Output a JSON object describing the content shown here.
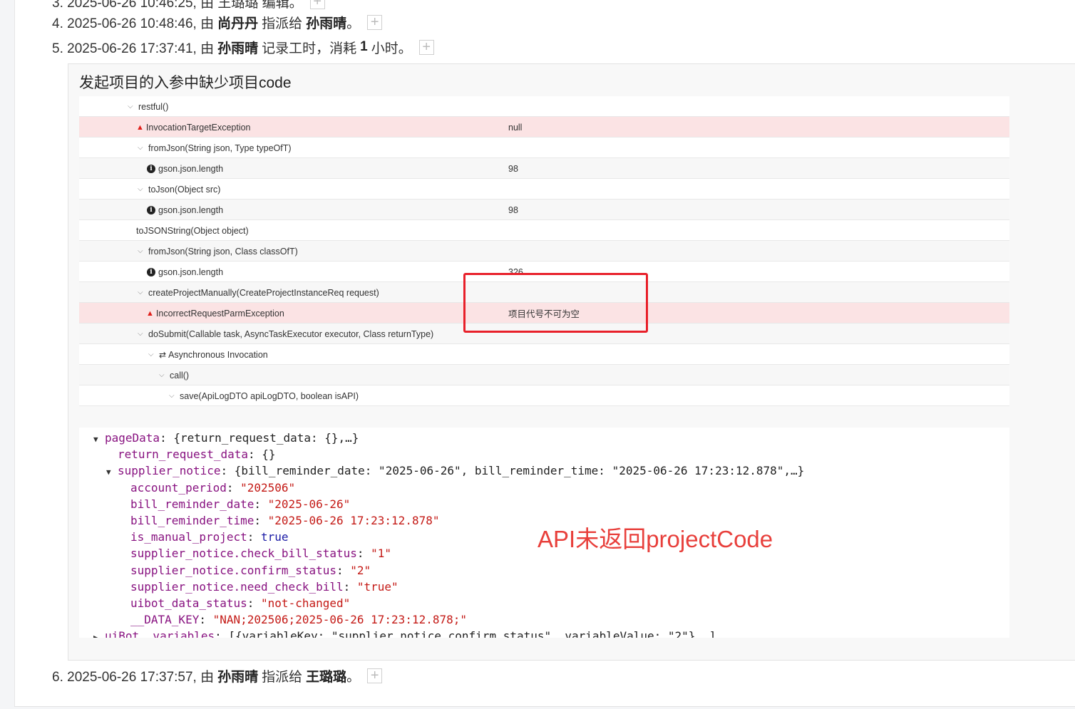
{
  "history": {
    "line3_partial": "3. 2025-06-26 10:46:25, 由 王璐璐 编辑。",
    "line4": {
      "prefix": "4. 2025-06-26 10:48:46, 由",
      "actor": "尚丹丹",
      "action": "指派给",
      "target": "孙雨晴",
      "suffix": "。"
    },
    "line5": {
      "prefix": "5. 2025-06-26 17:37:41, 由",
      "actor": "孙雨晴",
      "action": "记录工时，消耗",
      "count": "1",
      "suffix": "小时。"
    },
    "line6": {
      "prefix": "6. 2025-06-26 17:37:57, 由",
      "actor": "孙雨晴",
      "action": "指派给",
      "target": "王璐璐",
      "suffix": "。"
    },
    "plus_label": "+"
  },
  "comment": {
    "title": "发起项目的入参中缺少项目code",
    "trace_rows": [
      {
        "label": "restful()",
        "value": "",
        "kind": "node",
        "indent": 68,
        "chevron": "⌵"
      },
      {
        "label": "InvocationTargetException",
        "value": "null",
        "kind": "error",
        "indent": 80
      },
      {
        "label": "fromJson(String json, Type typeOfT)",
        "value": "",
        "kind": "node",
        "indent": 82,
        "chevron": "⌵"
      },
      {
        "label": "gson.json.length",
        "value": "98",
        "kind": "info",
        "indent": 95
      },
      {
        "label": "toJson(Object src)",
        "value": "",
        "kind": "node",
        "indent": 82,
        "chevron": "⌵"
      },
      {
        "label": "gson.json.length",
        "value": "98",
        "kind": "info",
        "indent": 95
      },
      {
        "label": "toJSONString(Object object)",
        "value": "",
        "kind": "node",
        "indent": 80
      },
      {
        "label": "fromJson(String json, Class classOfT)",
        "value": "",
        "kind": "node",
        "indent": 82,
        "chevron": "⌵"
      },
      {
        "label": "gson.json.length",
        "value": "326",
        "kind": "info",
        "indent": 95
      },
      {
        "label": "createProjectManually(CreateProjectInstanceReq request)",
        "value": "",
        "kind": "node",
        "indent": 82,
        "chevron": "⌵"
      },
      {
        "label": "IncorrectRequestParmException",
        "value": "项目代号不可为空",
        "kind": "error",
        "indent": 94
      },
      {
        "label": "doSubmit(Callable task, AsyncTaskExecutor executor, Class returnType)",
        "value": "",
        "kind": "node",
        "indent": 82,
        "chevron": "⌵"
      },
      {
        "label": "Asynchronous Invocation",
        "value": "",
        "kind": "async",
        "indent": 97,
        "chevron": "⌵"
      },
      {
        "label": "call()",
        "value": "",
        "kind": "node",
        "indent": 112,
        "chevron": "⌵"
      },
      {
        "label": "save(ApiLogDTO apiLogDTO, boolean isAPI)",
        "value": "",
        "kind": "node",
        "indent": 126,
        "chevron": "⌵"
      }
    ],
    "json_lines": [
      {
        "indent": 20,
        "tri": "▼",
        "parts": [
          [
            "k",
            "pageData"
          ],
          [
            "p",
            ": {return_request_data: {},…}"
          ]
        ]
      },
      {
        "indent": 54,
        "tri": "",
        "parts": [
          [
            "k",
            "return_request_data"
          ],
          [
            "p",
            ": {}"
          ]
        ]
      },
      {
        "indent": 38,
        "tri": "▼",
        "parts": [
          [
            "k",
            "supplier_notice"
          ],
          [
            "p",
            ": {bill_reminder_date: \"2025-06-26\", bill_reminder_time: \"2025-06-26 17:23:12.878\",…}"
          ]
        ]
      },
      {
        "indent": 72,
        "tri": "",
        "parts": [
          [
            "k",
            "account_period"
          ],
          [
            "p",
            ": "
          ],
          [
            "s",
            "\"202506\""
          ]
        ]
      },
      {
        "indent": 72,
        "tri": "",
        "parts": [
          [
            "k",
            "bill_reminder_date"
          ],
          [
            "p",
            ": "
          ],
          [
            "s",
            "\"2025-06-26\""
          ]
        ]
      },
      {
        "indent": 72,
        "tri": "",
        "parts": [
          [
            "k",
            "bill_reminder_time"
          ],
          [
            "p",
            ": "
          ],
          [
            "s",
            "\"2025-06-26 17:23:12.878\""
          ]
        ]
      },
      {
        "indent": 72,
        "tri": "",
        "parts": [
          [
            "k",
            "is_manual_project"
          ],
          [
            "p",
            ": "
          ],
          [
            "b",
            "true"
          ]
        ]
      },
      {
        "indent": 72,
        "tri": "",
        "parts": [
          [
            "k",
            "supplier_notice.check_bill_status"
          ],
          [
            "p",
            ": "
          ],
          [
            "s",
            "\"1\""
          ]
        ]
      },
      {
        "indent": 72,
        "tri": "",
        "parts": [
          [
            "k",
            "supplier_notice.confirm_status"
          ],
          [
            "p",
            ": "
          ],
          [
            "s",
            "\"2\""
          ]
        ]
      },
      {
        "indent": 72,
        "tri": "",
        "parts": [
          [
            "k",
            "supplier_notice.need_check_bill"
          ],
          [
            "p",
            ": "
          ],
          [
            "s",
            "\"true\""
          ]
        ]
      },
      {
        "indent": 72,
        "tri": "",
        "parts": [
          [
            "k",
            "uibot_data_status"
          ],
          [
            "p",
            ": "
          ],
          [
            "s",
            "\"not-changed\""
          ]
        ]
      },
      {
        "indent": 72,
        "tri": "",
        "parts": [
          [
            "k",
            "__DATA_KEY"
          ],
          [
            "p",
            ": "
          ],
          [
            "s",
            "\"NAN;202506;2025-06-26 17:23:12.878;\""
          ]
        ]
      },
      {
        "indent": 20,
        "tri": "▶",
        "parts": [
          [
            "k",
            "uiBot__variables"
          ],
          [
            "p",
            ": [{variableKey: \"supplier_notice.confirm_status\", variableValue: \"2\"},…]"
          ]
        ]
      }
    ],
    "annotation": "API未返回projectCode"
  },
  "colors": {
    "error_row": "#fbe3e4",
    "highlight_box": "#e8202a",
    "annotation": "#e8403c"
  }
}
